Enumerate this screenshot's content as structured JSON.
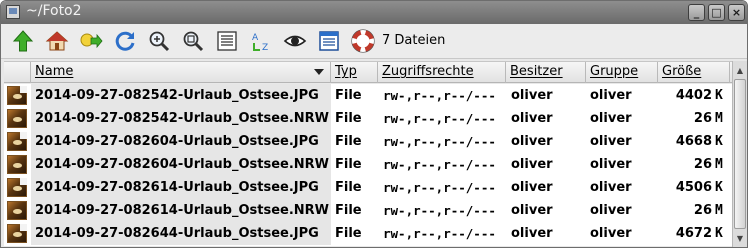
{
  "window": {
    "title": "~/Foto2",
    "controls": {
      "minimize": "_",
      "maximize": "□",
      "close": "×"
    }
  },
  "toolbar": {
    "buttons": [
      {
        "icon": "up-arrow-icon"
      },
      {
        "icon": "home-icon"
      },
      {
        "icon": "go-to-folder-icon"
      },
      {
        "icon": "refresh-icon"
      },
      {
        "icon": "zoom-in-icon"
      },
      {
        "icon": "zoom-fit-icon"
      },
      {
        "icon": "list-view-icon"
      },
      {
        "icon": "sort-az-icon"
      },
      {
        "icon": "show-hidden-eye-icon"
      },
      {
        "icon": "details-view-icon"
      },
      {
        "icon": "help-lifebuoy-icon"
      }
    ],
    "file_count": "7 Dateien"
  },
  "columns": {
    "name": "Name",
    "type": "Typ",
    "rights": "Zugriffsrechte",
    "owner": "Besitzer",
    "group": "Gruppe",
    "size": "Größe"
  },
  "files": [
    {
      "name": "2014-09-27-082542-Urlaub_Ostsee.JPG",
      "type": "File",
      "rights": "rw-,r--,r--/---",
      "owner": "oliver",
      "group": "oliver",
      "size": "4402",
      "unit": "K",
      "kind": "jpg"
    },
    {
      "name": "2014-09-27-082542-Urlaub_Ostsee.NRW",
      "type": "File",
      "rights": "rw-,r--,r--/---",
      "owner": "oliver",
      "group": "oliver",
      "size": "26",
      "unit": "M",
      "kind": "raw"
    },
    {
      "name": "2014-09-27-082604-Urlaub_Ostsee.JPG",
      "type": "File",
      "rights": "rw-,r--,r--/---",
      "owner": "oliver",
      "group": "oliver",
      "size": "4668",
      "unit": "K",
      "kind": "jpg"
    },
    {
      "name": "2014-09-27-082604-Urlaub_Ostsee.NRW",
      "type": "File",
      "rights": "rw-,r--,r--/---",
      "owner": "oliver",
      "group": "oliver",
      "size": "26",
      "unit": "M",
      "kind": "raw"
    },
    {
      "name": "2014-09-27-082614-Urlaub_Ostsee.JPG",
      "type": "File",
      "rights": "rw-,r--,r--/---",
      "owner": "oliver",
      "group": "oliver",
      "size": "4506",
      "unit": "K",
      "kind": "jpg"
    },
    {
      "name": "2014-09-27-082614-Urlaub_Ostsee.NRW",
      "type": "File",
      "rights": "rw-,r--,r--/---",
      "owner": "oliver",
      "group": "oliver",
      "size": "26",
      "unit": "M",
      "kind": "raw"
    },
    {
      "name": "2014-09-27-082644-Urlaub_Ostsee.JPG",
      "type": "File",
      "rights": "rw-,r--,r--/---",
      "owner": "oliver",
      "group": "oliver",
      "size": "4672",
      "unit": "K",
      "kind": "jpg"
    }
  ],
  "colors": {
    "titlebar": "#7a7a7a",
    "name_column_bg": "#e6e6e6"
  }
}
